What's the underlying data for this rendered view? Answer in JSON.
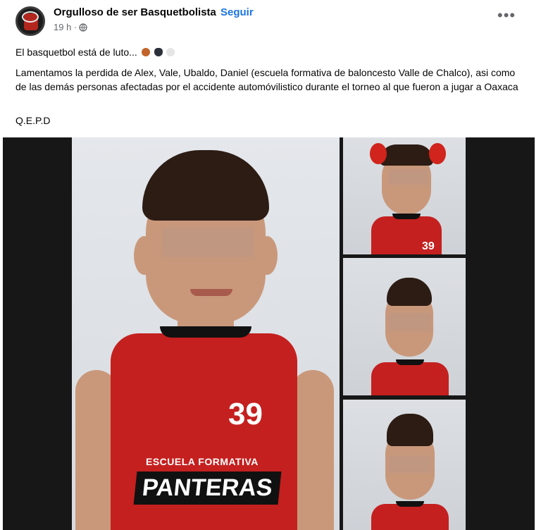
{
  "post": {
    "page_name": "Orgulloso de ser Basquetbolista",
    "separator": "·",
    "follow_label": "Seguir",
    "time": "19 h ·",
    "more_label": "•••",
    "line1": "El basquetbol está de luto...",
    "line2": "Lamentamos la perdida de Alex, Vale, Ubaldo, Daniel (escuela formativa de baloncesto Valle de Chalco), asi como de las demás personas afectadas por el accidente automóvilistico durante el torneo al que fueron a jugar a Oaxaca",
    "line3": "Q.E.P.D"
  },
  "photo": {
    "jersey_number_main": "39",
    "jersey_team_main": "ESCUELA FORMATIVA",
    "jersey_brand_main": "PANTERAS",
    "jersey_number_thumb": "39"
  },
  "colors": {
    "link": "#1b74e4",
    "jersey": "#c4201f",
    "emoji_ball": "#c2632a",
    "emoji_heart": "#2b2f3a",
    "emoji_dove": "#e5e5e5"
  },
  "icons": [
    "globe-icon",
    "more-options-icon",
    "basketball-emoji",
    "black-heart-emoji",
    "dove-emoji"
  ]
}
